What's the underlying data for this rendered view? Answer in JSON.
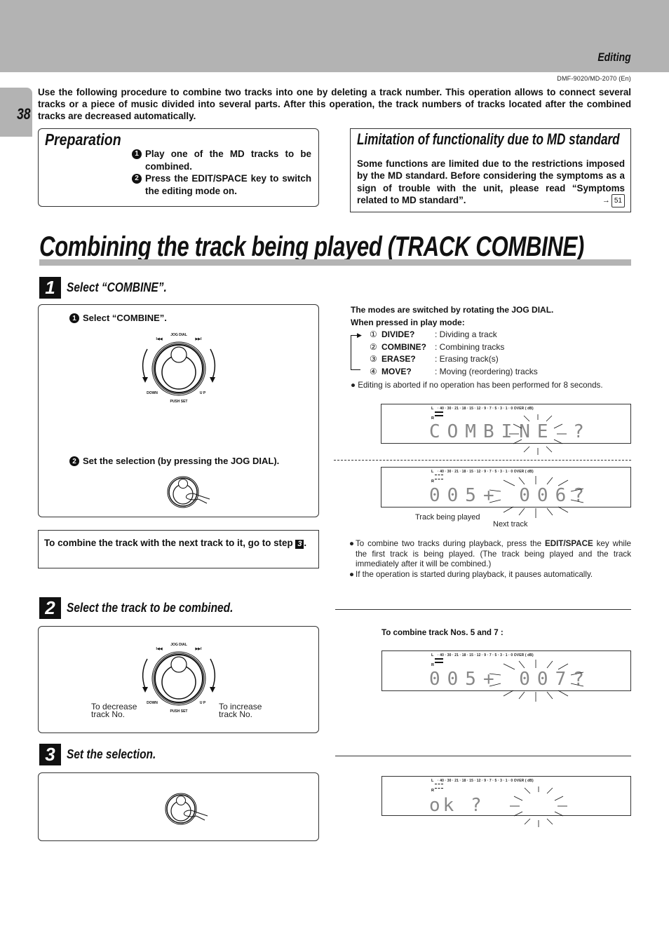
{
  "header": {
    "section": "Editing",
    "model_id": "DMF-9020/MD-2070 (En)",
    "page_number": "38"
  },
  "intro": "Use the following procedure to combine two tracks into one by deleting a track number. This operation allows to connect several tracks or a piece of music divided into several parts. After this operation, the track numbers of tracks located after the combined tracks are decreased automatically.",
  "preparation": {
    "title": "Preparation",
    "items": [
      {
        "num": "1",
        "text": "Play one of the MD tracks to be combined."
      },
      {
        "num": "2",
        "text": "Press the EDIT/SPACE key to switch the editing mode on."
      }
    ]
  },
  "limitation": {
    "title": "Limitation of functionality due to MD standard",
    "text": "Some functions are limited due to the restrictions imposed by the MD standard. Before considering the symptoms as a sign of trouble with the unit, please read “Symptoms related to MD standard”.",
    "ref_arrow": "→",
    "ref_page": "51"
  },
  "main_title": "Combining the track being played (TRACK  COMBINE)",
  "steps": [
    {
      "num": "1",
      "title": "Select “COMBINE”.",
      "sub1": {
        "num": "1",
        "text": "Select “COMBINE”."
      },
      "sub2": {
        "num": "2",
        "text": "Set the selection (by pressing the JOG DIAL)."
      },
      "goto_text": "To combine the track with the next track to it, go to step",
      "goto_step": "3",
      "goto_suffix": "."
    },
    {
      "num": "2",
      "title": "Select the track to be combined.",
      "left_caption": [
        "To decrease",
        "track No."
      ],
      "right_caption": [
        "To increase",
        "track No."
      ],
      "example_head": "To combine track Nos. 5 and 7 :"
    },
    {
      "num": "3",
      "title": "Set the selection."
    }
  ],
  "jog_dial": {
    "label": "JOG DIAL",
    "prev": "I◀◀",
    "next": "▶▶I",
    "down": "DOWN",
    "up": "U P",
    "push": "PUSH SET"
  },
  "modes": {
    "head1": "The modes are switched by rotating the JOG DIAL.",
    "head2": "When pressed in play mode:",
    "items": [
      {
        "num": "①",
        "name": "DIVIDE?",
        "desc": ": Dividing a track"
      },
      {
        "num": "②",
        "name": "COMBINE?",
        "desc": ": Combining tracks"
      },
      {
        "num": "③",
        "name": "ERASE?",
        "desc": ": Erasing track(s)"
      },
      {
        "num": "④",
        "name": "MOVE?",
        "desc": ": Moving (reordering) tracks"
      }
    ],
    "abort_note": "● Editing is aborted if no operation has been performed for 8 seconds."
  },
  "lcd": {
    "scale": "· 40 · 30 · 21 · 18 · 15 · 12 · 9 · 7 · 5 · 3 · 1 · 0  OVER ( dB)",
    "l": "L",
    "r": "R",
    "displays": [
      {
        "text": "COMBINE ?"
      },
      {
        "text": "005+ 006?",
        "caption_left": "Track being played",
        "caption_right": "Next track"
      },
      {
        "text": "005+ 007?"
      },
      {
        "text": "ok       ?"
      }
    ]
  },
  "playback_notes": [
    {
      "pre": "To combine two tracks during playback, press the ",
      "bold": "EDIT/SPACE",
      "post": " key while the first track is being played. (The track being played and the track immediately after it will be combined.)"
    },
    {
      "pre": "If the operation is started during playback, it pauses automatically.",
      "bold": "",
      "post": ""
    }
  ]
}
